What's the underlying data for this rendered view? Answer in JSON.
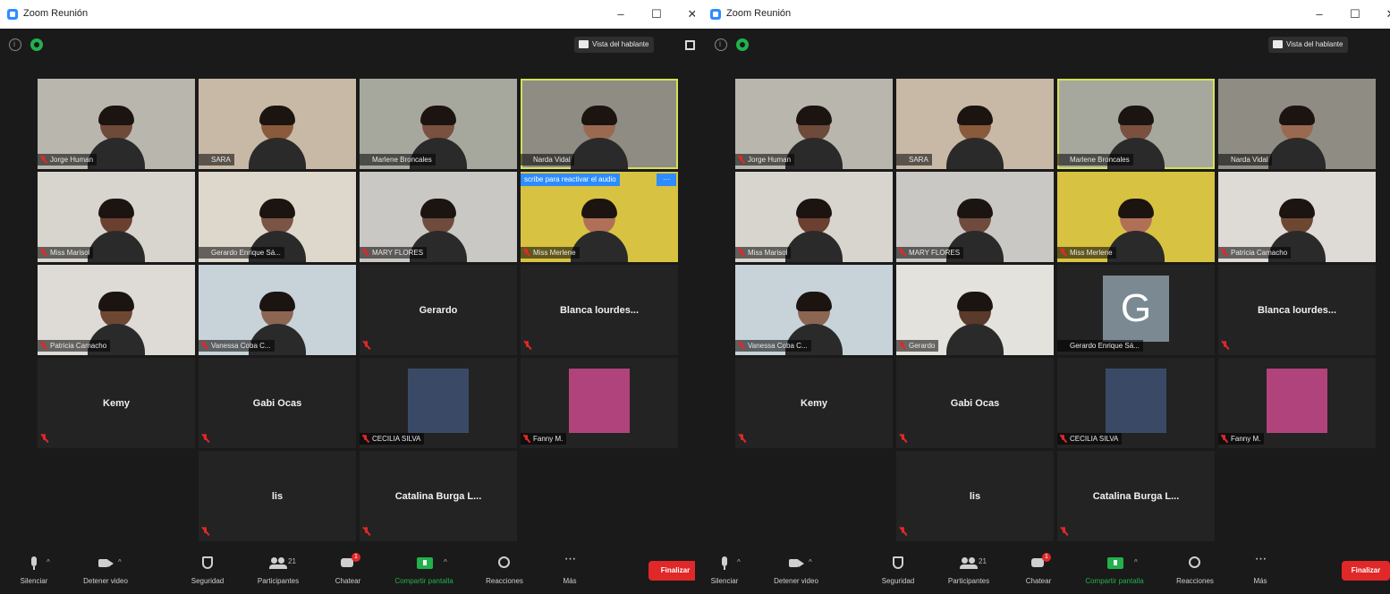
{
  "windows": [
    {
      "title": "Zoom Reunión",
      "view_label": "Vista del hablante",
      "tooltip": "scribe para reactivar el audio",
      "tooltip_extra": "···",
      "tiles": [
        {
          "name": "Jorge Human",
          "kind": "video",
          "bg": "#b9b6ae",
          "skin": "#6e4a3a",
          "muted": true
        },
        {
          "name": "SARA",
          "kind": "video",
          "bg": "#c8b9a6",
          "skin": "#8a5a3c",
          "muted": false
        },
        {
          "name": "Marlene Broncales",
          "kind": "video",
          "bg": "#a7a89d",
          "skin": "#7a5040",
          "muted": false
        },
        {
          "name": "Narda Vidal",
          "kind": "video",
          "bg": "#8f8c84",
          "skin": "#9a6a50",
          "muted": false,
          "active": true
        },
        {
          "name": "Miss Marisol",
          "kind": "video",
          "bg": "#d8d5cf",
          "skin": "#6b4030",
          "muted": true
        },
        {
          "name": "Gerardo Enrique Sá...",
          "kind": "video",
          "bg": "#ded8cc",
          "skin": "#7a5444",
          "muted": false
        },
        {
          "name": "MARY FLORES",
          "kind": "video",
          "bg": "#c9c8c4",
          "skin": "#6e4b3d",
          "muted": true
        },
        {
          "name": "Miss Merlene",
          "kind": "video",
          "bg": "#d8c242",
          "skin": "#b07058",
          "muted": true
        },
        {
          "name": "Patricia Camacho",
          "kind": "video",
          "bg": "#dedad6",
          "skin": "#6e4733",
          "muted": true
        },
        {
          "name": "Vanessa Coba C...",
          "kind": "video",
          "bg": "#c7d3d9",
          "skin": "#8c6553",
          "muted": true
        },
        {
          "name": "Gerardo",
          "kind": "text",
          "muted": true
        },
        {
          "name": "Blanca lourdes...",
          "kind": "text",
          "muted": true
        },
        {
          "name": "Kemy",
          "kind": "text",
          "muted": true
        },
        {
          "name": "Gabi Ocas",
          "kind": "text",
          "muted": true
        },
        {
          "name": "CECILIA SILVA",
          "kind": "picture",
          "pic": "#3a4a66",
          "muted": true
        },
        {
          "name": "Fanny M.",
          "kind": "picture",
          "pic": "#b0437b",
          "muted": true
        },
        {
          "name": "lis",
          "kind": "text",
          "muted": true
        },
        {
          "name": "Catalina Burga L...",
          "kind": "text",
          "muted": true
        }
      ]
    },
    {
      "title": "Zoom Reunión",
      "view_label": "Vista del hablante",
      "tiles": [
        {
          "name": "Jorge Human",
          "kind": "video",
          "bg": "#b9b6ae",
          "skin": "#6e4a3a",
          "muted": true
        },
        {
          "name": "SARA",
          "kind": "video",
          "bg": "#c8b9a6",
          "skin": "#8a5a3c",
          "muted": false
        },
        {
          "name": "Marlene Broncales",
          "kind": "video",
          "bg": "#a7a89d",
          "skin": "#7a5040",
          "muted": false,
          "active": true
        },
        {
          "name": "Narda Vidal",
          "kind": "video",
          "bg": "#8f8c84",
          "skin": "#9a6a50",
          "muted": false
        },
        {
          "name": "Miss Marisol",
          "kind": "video",
          "bg": "#d8d5cf",
          "skin": "#6b4030",
          "muted": true
        },
        {
          "name": "MARY FLORES",
          "kind": "video",
          "bg": "#c9c8c4",
          "skin": "#6e4b3d",
          "muted": true
        },
        {
          "name": "Miss Merlene",
          "kind": "video",
          "bg": "#d8c242",
          "skin": "#b07058",
          "muted": true
        },
        {
          "name": "Patricia Camacho",
          "kind": "video",
          "bg": "#dedad6",
          "skin": "#6e4733",
          "muted": true
        },
        {
          "name": "Vanessa Coba C...",
          "kind": "video",
          "bg": "#c7d3d9",
          "skin": "#8c6553",
          "muted": true
        },
        {
          "name": "Gerardo",
          "kind": "video",
          "bg": "#e4e2dc",
          "skin": "#5a3a2a",
          "muted": true
        },
        {
          "name": "Gerardo Enrique Sá...",
          "kind": "letter",
          "letter": "G",
          "muted": false
        },
        {
          "name": "Blanca lourdes...",
          "kind": "text",
          "muted": true
        },
        {
          "name": "Kemy",
          "kind": "text",
          "muted": true
        },
        {
          "name": "Gabi Ocas",
          "kind": "text",
          "muted": true
        },
        {
          "name": "CECILIA SILVA",
          "kind": "picture",
          "pic": "#3a4a66",
          "muted": true
        },
        {
          "name": "Fanny M.",
          "kind": "picture",
          "pic": "#b0437b",
          "muted": true
        },
        {
          "name": "lis",
          "kind": "text",
          "muted": true
        },
        {
          "name": "Catalina Burga L...",
          "kind": "text",
          "muted": true
        }
      ]
    }
  ],
  "toolbar": {
    "mute": "Silenciar",
    "video": "Detener video",
    "security": "Seguridad",
    "participants": "Participantes",
    "participants_count": "21",
    "chat": "Chatear",
    "chat_badge": "1",
    "share": "Compartir pantalla",
    "reactions": "Reacciones",
    "more": "Más",
    "end": "Finalizar"
  },
  "colors": {
    "accent_blue": "#2d8cff",
    "end_red": "#e02828",
    "share_green": "#22b14c",
    "active_speaker": "#d4e157"
  }
}
